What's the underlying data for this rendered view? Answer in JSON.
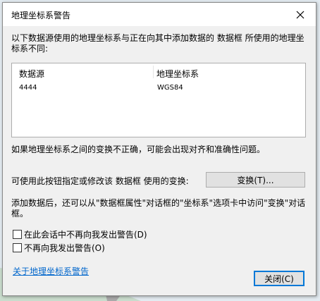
{
  "dialog": {
    "title": "地理坐标系警告",
    "description": "以下数据源使用的地理坐标系与正在向其中添加数据的 数据框 所使用的地理坐标系不同:",
    "table": {
      "headers": [
        "数据源",
        "地理坐标系"
      ],
      "rows": [
        [
          "4444",
          "WGS84"
        ]
      ]
    },
    "warning_text": "如果地理坐标系之间的变换不正确，可能会出现对齐和准确性问题。",
    "modify_label": "可使用此按钮指定或修改该 数据框 使用的变换:",
    "transform_button": "变换(T)...",
    "hint_text": "添加数据后，还可以从\"数据框属性\"对话框的\"坐标系\"选项卡中访问\"变换\"对话框。",
    "checkbox_session": "在此会话中不再向我发出警告(D)",
    "checkbox_never": "不再向我发出警告(O)",
    "about_link": "关于地理坐标系警告",
    "close_button": "关闭(C)"
  },
  "colors": {
    "accent": "#0078d7",
    "link": "#0066cc",
    "dialog_bg": "#f0f0f0"
  },
  "icons": [
    "close-icon",
    "checkbox-icon"
  ]
}
